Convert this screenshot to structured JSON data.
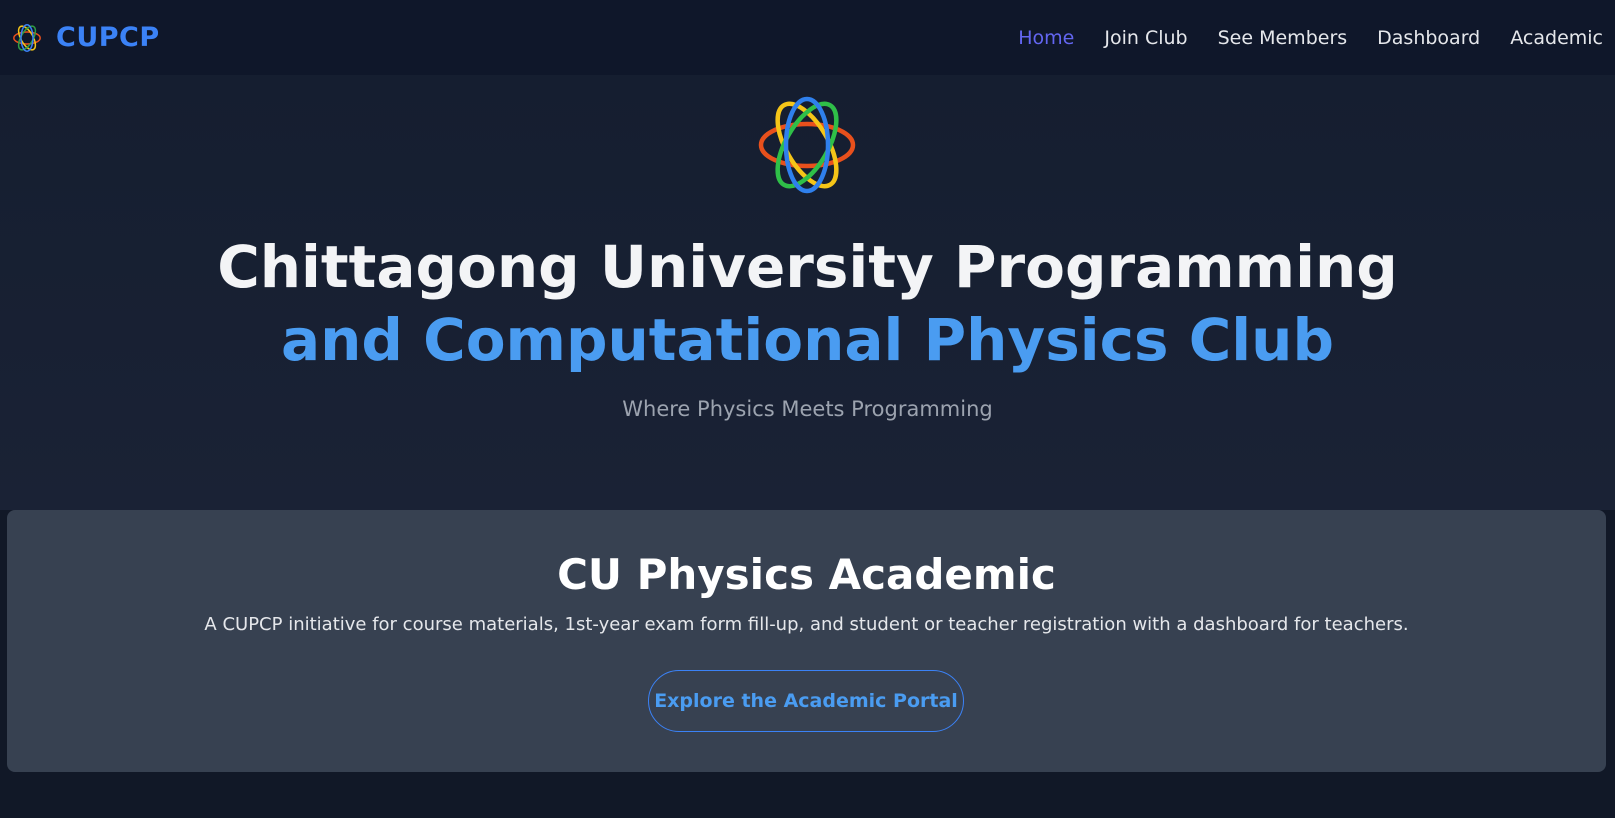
{
  "brand": {
    "name": "CUPCP",
    "logo_icon": "atom-icon",
    "color": "#3b82f6"
  },
  "nav": {
    "items": [
      {
        "label": "Home",
        "active": true
      },
      {
        "label": "Join Club",
        "active": false
      },
      {
        "label": "See Members",
        "active": false
      },
      {
        "label": "Dashboard",
        "active": false
      },
      {
        "label": "Academic",
        "active": false
      }
    ],
    "active_color": "#6366f1"
  },
  "hero": {
    "logo_icon": "atom-icon",
    "title_line1": "Chittagong University Programming",
    "title_line2": "and Computational Physics Club",
    "subtitle": "Where Physics Meets Programming",
    "accent_color": "#4a9cf1"
  },
  "academic": {
    "title": "CU Physics Academic",
    "description": "A CUPCP initiative for course materials, 1st-year exam form fill-up, and student or teacher registration with a dashboard for teachers.",
    "button_label": "Explore the Academic Portal"
  }
}
